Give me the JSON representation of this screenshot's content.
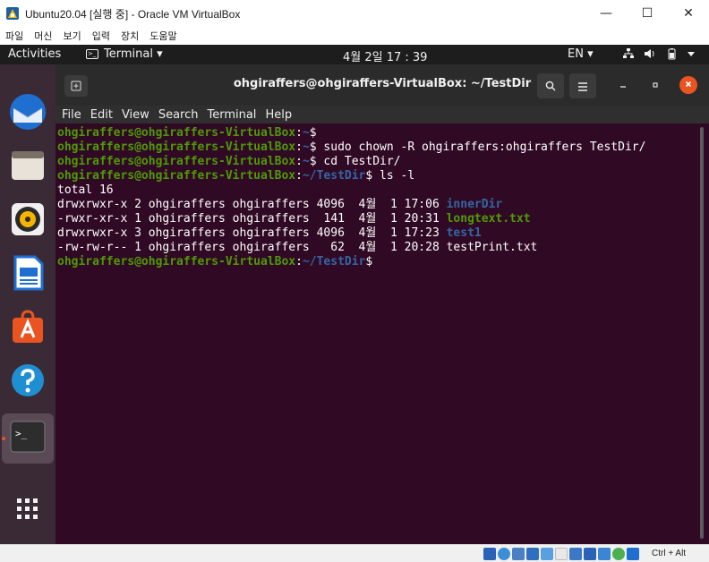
{
  "vbox": {
    "title": "Ubuntu20.04 [실행 중] - Oracle VM VirtualBox",
    "menu": [
      "파일",
      "머신",
      "보기",
      "입력",
      "장치",
      "도움말"
    ],
    "window_controls": {
      "minimize": "—",
      "maximize": "☐",
      "close": "✕"
    },
    "host_key": "Ctrl + Alt"
  },
  "gnome": {
    "activities": "Activities",
    "app_menu": "Terminal ▾",
    "clock": "4월 2일  17 : 39",
    "lang": "EN ▾",
    "status_icons": [
      "network-icon",
      "volume-icon",
      "battery-icon",
      "system-menu-icon"
    ]
  },
  "dock": {
    "items": [
      "thunderbird-icon",
      "files-icon",
      "rhythmbox-icon",
      "libreoffice-writer-icon",
      "software-center-icon",
      "help-icon",
      "terminal-icon",
      "show-applications-icon"
    ]
  },
  "terminal": {
    "title": "ohgiraffers@ohgiraffers-VirtualBox: ~/TestDir",
    "menu": [
      "File",
      "Edit",
      "View",
      "Search",
      "Terminal",
      "Help"
    ],
    "lines": [
      [
        {
          "t": "ohgiraffers@ohgiraffers-VirtualBox",
          "c": "user"
        },
        {
          "t": ":",
          "c": "plain"
        },
        {
          "t": "~",
          "c": "path"
        },
        {
          "t": "$",
          "c": "plain"
        }
      ],
      [
        {
          "t": "ohgiraffers@ohgiraffers-VirtualBox",
          "c": "user"
        },
        {
          "t": ":",
          "c": "plain"
        },
        {
          "t": "~",
          "c": "path"
        },
        {
          "t": "$ sudo chown -R ohgiraffers:ohgiraffers TestDir/",
          "c": "plain"
        }
      ],
      [
        {
          "t": "ohgiraffers@ohgiraffers-VirtualBox",
          "c": "user"
        },
        {
          "t": ":",
          "c": "plain"
        },
        {
          "t": "~",
          "c": "path"
        },
        {
          "t": "$ cd TestDir/",
          "c": "plain"
        }
      ],
      [
        {
          "t": "ohgiraffers@ohgiraffers-VirtualBox",
          "c": "user"
        },
        {
          "t": ":",
          "c": "plain"
        },
        {
          "t": "~/TestDir",
          "c": "path"
        },
        {
          "t": "$ ls -l",
          "c": "plain"
        }
      ],
      [
        {
          "t": "total 16",
          "c": "plain"
        }
      ],
      [
        {
          "t": "drwxrwxr-x 2 ohgiraffers ohgiraffers 4096  4월  1 17:06 ",
          "c": "plain"
        },
        {
          "t": "innerDir",
          "c": "dir"
        }
      ],
      [
        {
          "t": "-rwxr-xr-x 1 ohgiraffers ohgiraffers  141  4월  1 20:31 ",
          "c": "plain"
        },
        {
          "t": "longtext.txt",
          "c": "exec"
        }
      ],
      [
        {
          "t": "drwxrwxr-x 3 ohgiraffers ohgiraffers 4096  4월  1 17:23 ",
          "c": "plain"
        },
        {
          "t": "test1",
          "c": "dir"
        }
      ],
      [
        {
          "t": "-rw-rw-r-- 1 ohgiraffers ohgiraffers   62  4월  1 20:28 testPrint.txt",
          "c": "plain"
        }
      ],
      [
        {
          "t": "ohgiraffers@ohgiraffers-VirtualBox",
          "c": "user"
        },
        {
          "t": ":",
          "c": "plain"
        },
        {
          "t": "~/TestDir",
          "c": "path"
        },
        {
          "t": "$",
          "c": "plain"
        }
      ]
    ]
  },
  "colors": {
    "terminal_bg": "#300a24",
    "prompt_user": "#4e9a06",
    "prompt_path": "#3465a4",
    "accent": "#e95420"
  }
}
